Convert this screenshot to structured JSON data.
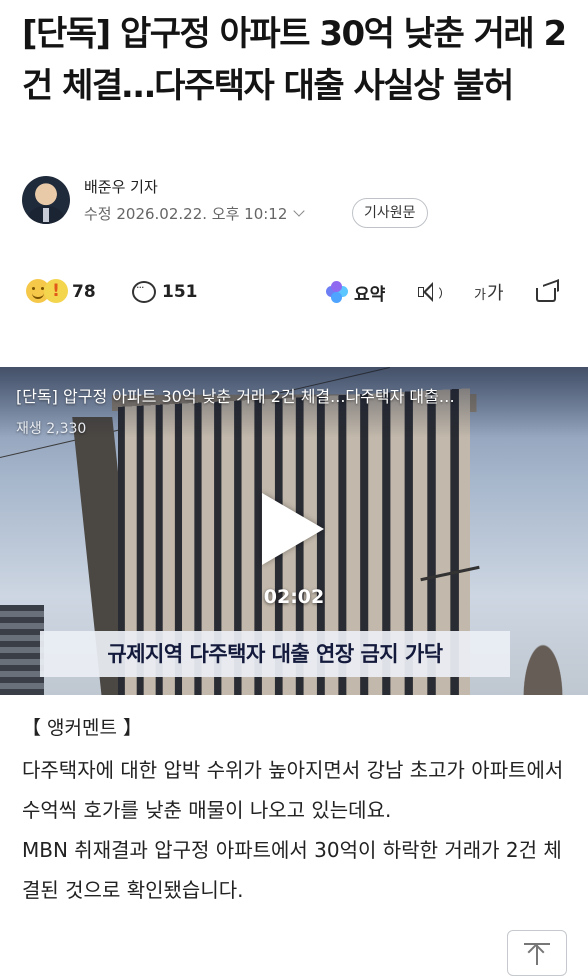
{
  "article": {
    "headline": "[단독] 압구정 아파트 30억 낮춘 거래 2건 체결…다주택자 대출 사실상 불허",
    "reporter": "배준우 기자",
    "updated": "수정 2026.02.22. 오후 10:12",
    "original_button": "기사원문"
  },
  "reactions": {
    "emotion_count": "78",
    "comment_count": "151",
    "summary_label": "요약",
    "font_size_label_small": "가",
    "font_size_label_large": "가"
  },
  "video": {
    "title": "[단독] 압구정 아파트 30억 낮춘 거래 2건 체결...다주택자 대출…",
    "views": "재생 2,330",
    "duration": "02:02",
    "caption": "규제지역 다주택자 대출 연장 금지 가닥"
  },
  "body": {
    "anchor_label": "【 앵커멘트 】",
    "paragraph1": "다주택자에 대한 압박 수위가 높아지면서 강남 초고가 아파트에서 수억씩 호가를 낮춘 매물이 나오고 있는데요.",
    "paragraph2": "MBN 취재결과 압구정 아파트에서 30억이 하락한 거래가 2건 체결된 것으로 확인됐습니다."
  },
  "icons": [
    "smile-emoji-icon",
    "surprise-emoji-icon",
    "comment-icon",
    "ai-summary-icon",
    "speaker-icon",
    "font-size-icon",
    "share-icon",
    "play-icon",
    "scroll-top-icon"
  ]
}
